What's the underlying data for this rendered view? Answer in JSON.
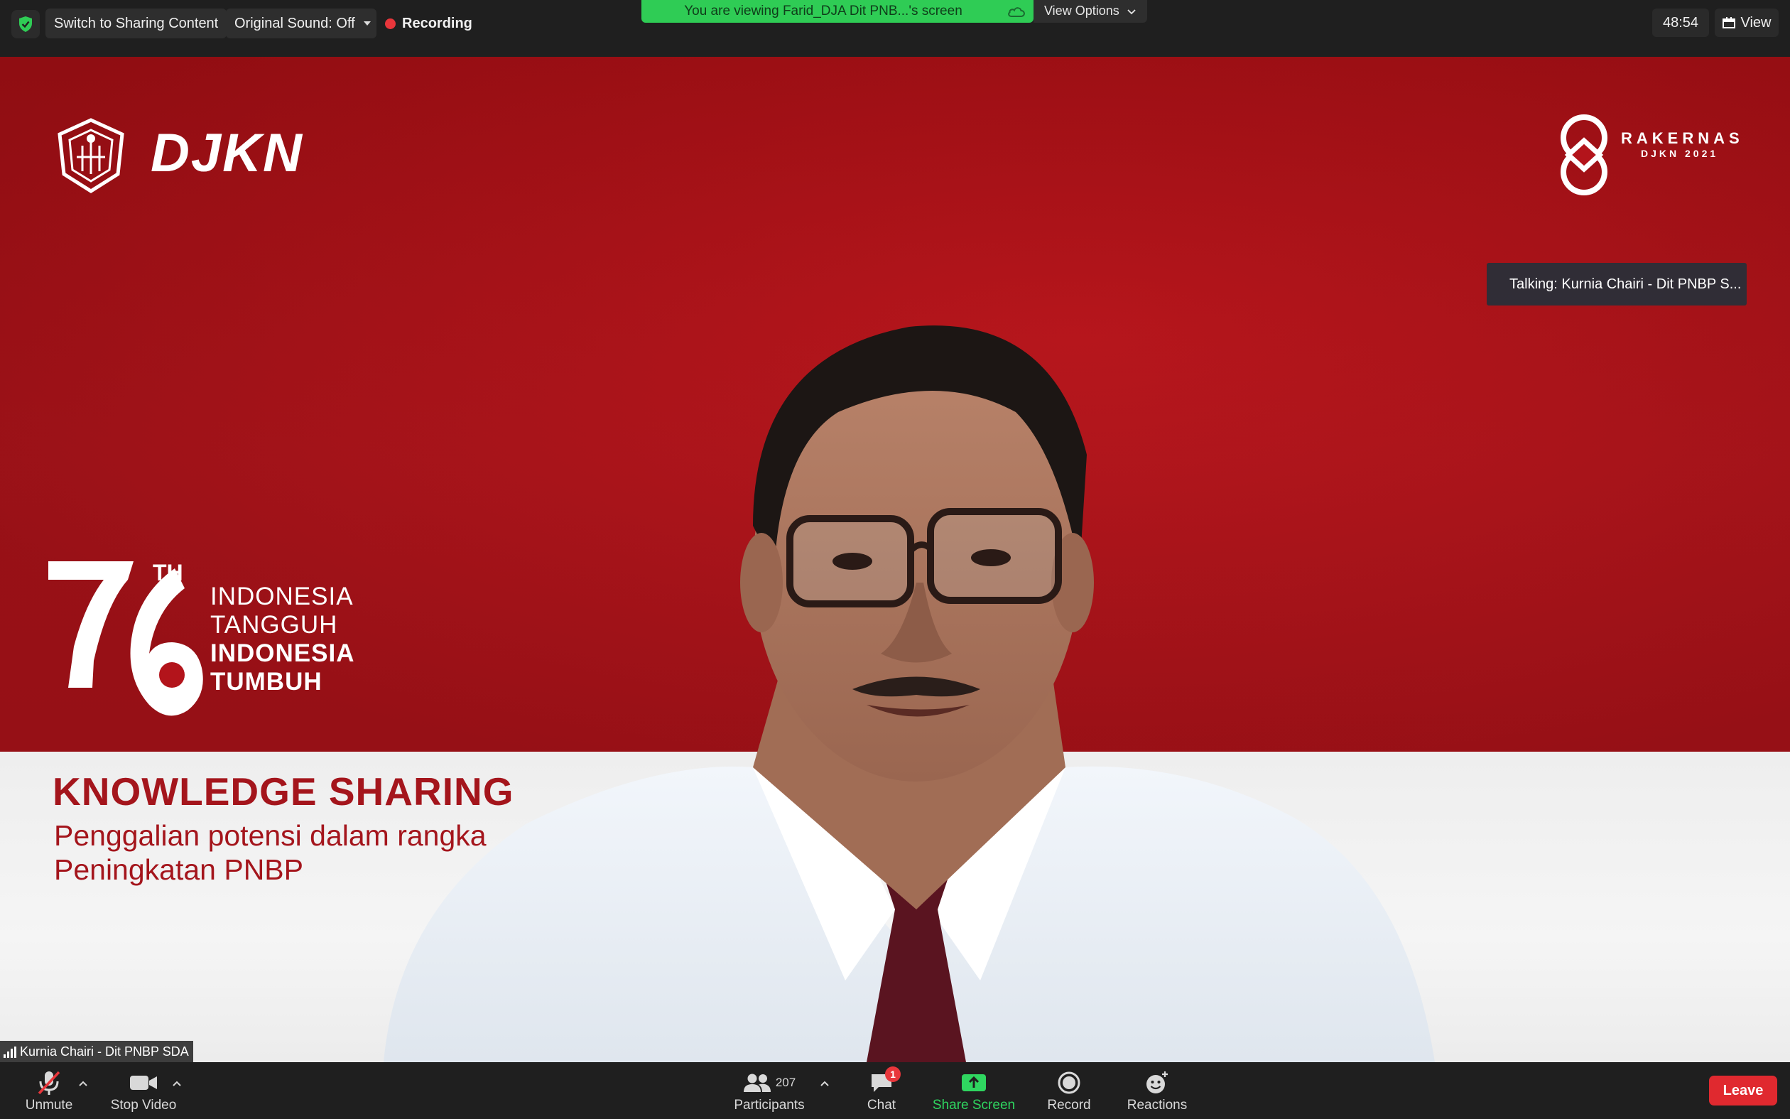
{
  "topbar": {
    "switch_label": "Switch to Sharing Content",
    "sound_label": "Original Sound: Off",
    "recording_label": "Recording",
    "viewing_label": "You are viewing Farid_DJA Dit PNB...'s screen",
    "view_options_label": "View Options",
    "timer": "48:54",
    "view_label": "View"
  },
  "slide": {
    "brand": "DJKN",
    "event_title": "RAKERNAS",
    "event_sub": "DJKN 2021",
    "th": "TH",
    "tagline": [
      "INDONESIA",
      "TANGGUH",
      "INDONESIA",
      "TUMBUH"
    ],
    "heading": "KNOWLEDGE SHARING",
    "subtitle": [
      "Penggalian potensi dalam rangka",
      "Peningkatan PNBP"
    ]
  },
  "talking": "Talking: Kurnia Chairi - Dit PNBP S...",
  "participant_name": "Kurnia Chairi - Dit PNBP SDA",
  "toolbar": {
    "unmute": "Unmute",
    "stop_video": "Stop Video",
    "participants": "Participants",
    "participant_count": "207",
    "chat": "Chat",
    "chat_badge": "1",
    "share_screen": "Share Screen",
    "record": "Record",
    "reactions": "Reactions",
    "leave": "Leave"
  },
  "colors": {
    "accent_green": "#2fcc55",
    "leave_red": "#e0292f",
    "slide_red": "#b3141b"
  }
}
